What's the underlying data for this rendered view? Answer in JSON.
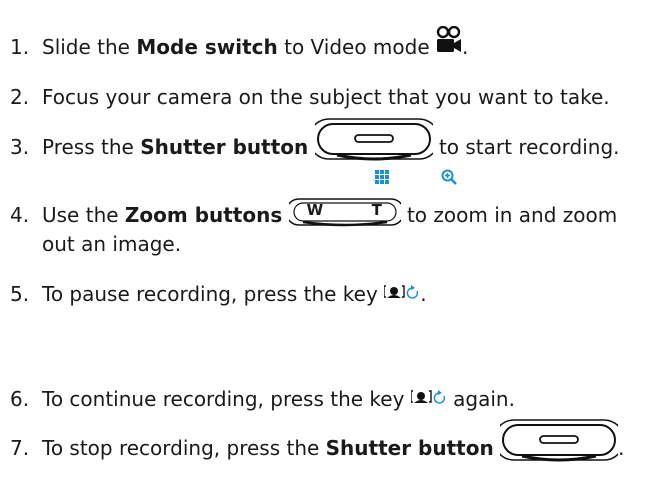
{
  "steps": [
    {
      "num": "1.",
      "pre": "Slide the ",
      "bold": "Mode switch",
      "post": " to Video mode ",
      "tail": "."
    },
    {
      "num": "2.",
      "text": "Focus your camera on the subject that you want to take."
    },
    {
      "num": "3.",
      "pre": "Press the ",
      "bold": "Shutter button",
      "post": " to start recording."
    },
    {
      "num": "4.",
      "pre": "Use the ",
      "bold": "Zoom buttons",
      "post": " to zoom in and zoom",
      "cont": "out an image.",
      "btn_w": "W",
      "btn_t": "T"
    },
    {
      "num": "5.",
      "pre": "To pause recording, press the key ",
      "tail": "."
    },
    {
      "num": "6.",
      "pre": "To continue recording, press the key ",
      "tail": " again."
    },
    {
      "num": "7.",
      "pre": "To stop recording, press the ",
      "bold": "Shutter button",
      "tail": "."
    }
  ],
  "icons": [
    "video-camera-icon",
    "shutter-button-icon",
    "zoom-wide-grid-icon",
    "zoom-tele-magnifier-icon",
    "zoom-buttons-icon",
    "pause-record-key-icon"
  ],
  "accent_color": "#1a8fd6"
}
